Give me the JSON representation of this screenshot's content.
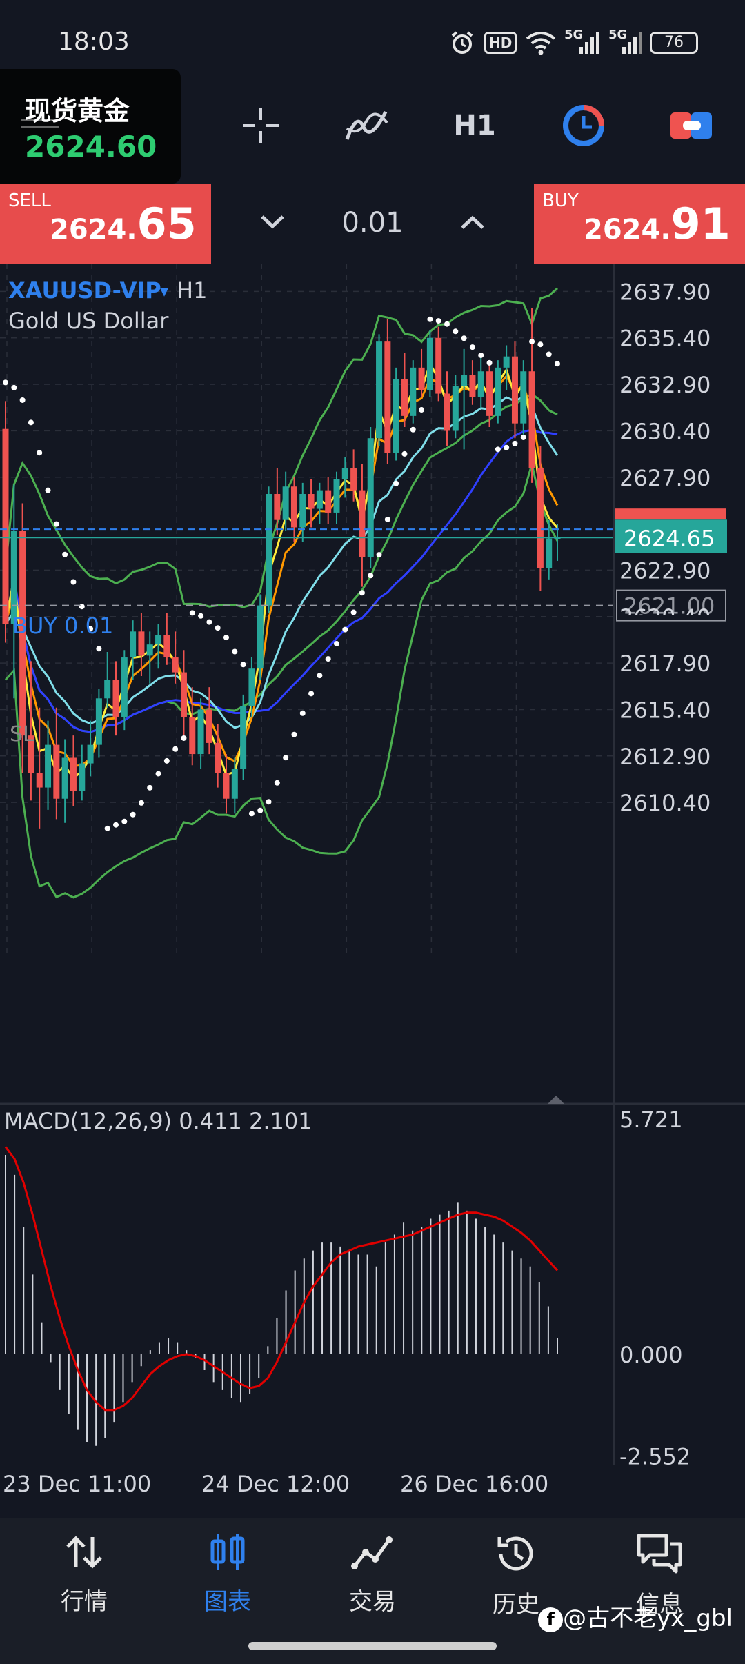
{
  "status_bar": {
    "time": "18:03",
    "icons": [
      "alarm-icon",
      "hd-icon",
      "wifi-icon",
      "signal-5g-icon",
      "signal-5g-icon"
    ],
    "hd_label": "HD",
    "net1": "5G",
    "net2": "5G",
    "battery": "76"
  },
  "symbol_card": {
    "name": "现货黄金",
    "price": "2624.60"
  },
  "toolbar": {
    "crosshair_icon": "crosshair-icon",
    "indicator_icon": "indicator-icon",
    "timeframe": "H1",
    "clock_icon": "chart-clock-icon",
    "toggle_icon": "toggle-icon"
  },
  "trade": {
    "sell_label": "SELL",
    "sell_price_main": "2624.",
    "sell_price_big": "65",
    "lot_minus": "˅",
    "lot": "0.01",
    "lot_plus": "˄",
    "buy_label": "BUY",
    "buy_price_main": "2624.",
    "buy_price_big": "91"
  },
  "chart": {
    "symbol": "XAUUSD-VIP",
    "dropdown_glyph": "▾",
    "timeframe": "H1",
    "description": "Gold US Dollar",
    "position_label": "BUY 0.01",
    "sl_label": "SL",
    "current_price_tag": "2624.65",
    "sl_price_tag": "2621.00",
    "overlap_label": "2620.40",
    "macd_label": "MACD(12,26,9) 0.411 2.101",
    "colors": {
      "bull": "#26a69a",
      "bear": "#ef5350",
      "bb": "#4caf50",
      "ma_fast": "#ffeb3b",
      "ma_mid": "#ff9800",
      "ma_cyan": "#80deea",
      "ma_blue": "#2f3fff",
      "macd_signal": "#e00000"
    }
  },
  "chart_data": [
    {
      "type": "candlestick",
      "title": "XAUUSD-VIP H1",
      "y_ticks": [
        2637.9,
        2635.4,
        2632.9,
        2630.4,
        2627.9,
        2622.9,
        2620.4,
        2617.9,
        2615.4,
        2612.9,
        2610.4
      ],
      "ylim": [
        2608.4,
        2639.4
      ],
      "x_tick_labels": [
        "23 Dec 11:00",
        "24 Dec 12:00",
        "26 Dec 16:00"
      ],
      "x_tick_index": [
        0,
        28,
        56
      ],
      "current_price": 2624.65,
      "stop_loss": 2621.0,
      "position_price": 2625.1,
      "ohlc": [
        [
          2630.5,
          2632.0,
          2619.0,
          2620.0
        ],
        [
          2620.0,
          2627.5,
          2616.0,
          2625.0
        ],
        [
          2625.0,
          2626.5,
          2612.0,
          2614.0
        ],
        [
          2614.0,
          2618.0,
          2610.5,
          2612.0
        ],
        [
          2612.0,
          2615.5,
          2609.0,
          2611.2
        ],
        [
          2611.2,
          2614.8,
          2610.0,
          2613.5
        ],
        [
          2613.5,
          2615.5,
          2609.5,
          2610.6
        ],
        [
          2610.6,
          2613.8,
          2609.3,
          2612.8
        ],
        [
          2612.8,
          2614.0,
          2610.2,
          2611.0
        ],
        [
          2611.0,
          2613.5,
          2610.5,
          2612.5
        ],
        [
          2612.5,
          2614.8,
          2611.8,
          2613.5
        ],
        [
          2613.5,
          2616.5,
          2612.8,
          2616.0
        ],
        [
          2616.0,
          2618.5,
          2615.5,
          2617.0
        ],
        [
          2617.0,
          2618.0,
          2614.0,
          2615.0
        ],
        [
          2615.0,
          2618.6,
          2614.3,
          2618.2
        ],
        [
          2618.2,
          2620.2,
          2617.0,
          2619.6
        ],
        [
          2619.6,
          2620.6,
          2617.2,
          2618.3
        ],
        [
          2618.3,
          2619.6,
          2616.8,
          2618.9
        ],
        [
          2618.9,
          2620.0,
          2617.6,
          2619.4
        ],
        [
          2619.4,
          2620.6,
          2617.8,
          2618.2
        ],
        [
          2618.2,
          2619.6,
          2616.8,
          2617.4
        ],
        [
          2617.4,
          2618.6,
          2614.0,
          2615.0
        ],
        [
          2615.0,
          2616.6,
          2612.4,
          2613.0
        ],
        [
          2613.0,
          2616.0,
          2612.2,
          2615.4
        ],
        [
          2615.4,
          2616.6,
          2613.0,
          2613.6
        ],
        [
          2613.6,
          2614.6,
          2611.2,
          2612.0
        ],
        [
          2612.0,
          2613.0,
          2609.8,
          2610.6
        ],
        [
          2610.6,
          2612.8,
          2609.8,
          2612.2
        ],
        [
          2612.2,
          2616.2,
          2611.6,
          2615.6
        ],
        [
          2615.6,
          2618.2,
          2615.0,
          2617.6
        ],
        [
          2617.6,
          2621.6,
          2617.0,
          2621.0
        ],
        [
          2621.0,
          2627.4,
          2620.6,
          2627.0
        ],
        [
          2627.0,
          2628.4,
          2624.8,
          2625.6
        ],
        [
          2625.6,
          2628.2,
          2625.0,
          2627.4
        ],
        [
          2627.4,
          2627.9,
          2624.4,
          2625.2
        ],
        [
          2625.2,
          2627.6,
          2624.4,
          2627.0
        ],
        [
          2627.0,
          2627.8,
          2625.2,
          2626.2
        ],
        [
          2626.2,
          2627.6,
          2625.4,
          2627.2
        ],
        [
          2627.2,
          2627.9,
          2625.4,
          2626.0
        ],
        [
          2626.0,
          2628.2,
          2625.4,
          2627.8
        ],
        [
          2627.8,
          2629.0,
          2626.8,
          2628.4
        ],
        [
          2628.4,
          2629.4,
          2626.6,
          2627.2
        ],
        [
          2627.2,
          2628.6,
          2622.0,
          2623.6
        ],
        [
          2623.6,
          2630.6,
          2623.0,
          2630.0
        ],
        [
          2630.0,
          2635.6,
          2629.6,
          2635.2
        ],
        [
          2635.2,
          2636.4,
          2628.6,
          2629.2
        ],
        [
          2629.2,
          2633.8,
          2628.8,
          2633.2
        ],
        [
          2633.2,
          2634.6,
          2630.6,
          2631.2
        ],
        [
          2631.2,
          2634.2,
          2630.8,
          2633.8
        ],
        [
          2633.8,
          2634.8,
          2632.2,
          2632.6
        ],
        [
          2632.6,
          2635.8,
          2632.2,
          2635.4
        ],
        [
          2635.4,
          2636.0,
          2632.0,
          2632.4
        ],
        [
          2632.4,
          2633.6,
          2629.6,
          2630.4
        ],
        [
          2630.4,
          2633.4,
          2630.0,
          2632.8
        ],
        [
          2632.8,
          2634.8,
          2629.4,
          2633.4
        ],
        [
          2633.4,
          2634.2,
          2631.8,
          2632.2
        ],
        [
          2632.2,
          2634.4,
          2631.6,
          2633.6
        ],
        [
          2633.6,
          2634.0,
          2630.6,
          2631.2
        ],
        [
          2631.2,
          2634.2,
          2630.8,
          2633.8
        ],
        [
          2633.8,
          2635.0,
          2632.6,
          2634.4
        ],
        [
          2634.4,
          2635.2,
          2630.0,
          2630.8
        ],
        [
          2630.8,
          2634.2,
          2630.2,
          2633.6
        ],
        [
          2633.6,
          2637.0,
          2627.6,
          2628.4
        ],
        [
          2628.4,
          2629.6,
          2621.8,
          2623.0
        ],
        [
          2623.0,
          2625.6,
          2622.4,
          2624.6
        ],
        [
          2624.6,
          2625.4,
          2623.4,
          2624.65
        ]
      ]
    },
    {
      "type": "bar",
      "title": "MACD(12,26,9) 0.411 2.101",
      "y_ticks": [
        5.721,
        0.0,
        -2.552
      ],
      "ylim": [
        -3.1,
        5.9
      ],
      "x_tick_labels": [
        "23 Dec 11:00",
        "24 Dec 12:00",
        "26 Dec 16:00"
      ],
      "histogram": [
        5.0,
        4.5,
        3.2,
        2.0,
        0.8,
        -0.2,
        -0.9,
        -1.5,
        -1.9,
        -2.2,
        -2.3,
        -2.1,
        -1.7,
        -1.2,
        -0.7,
        -0.3,
        0.1,
        0.3,
        0.4,
        0.3,
        0.1,
        -0.1,
        -0.4,
        -0.7,
        -0.9,
        -1.1,
        -1.2,
        -1.0,
        -0.6,
        0.2,
        0.9,
        1.6,
        2.1,
        2.4,
        2.6,
        2.8,
        2.8,
        2.7,
        2.6,
        2.5,
        2.5,
        2.2,
        2.8,
        3.0,
        3.3,
        3.1,
        3.2,
        3.4,
        3.5,
        3.6,
        3.8,
        3.6,
        3.4,
        3.2,
        3.0,
        2.8,
        2.6,
        2.4,
        2.2,
        1.8,
        1.2,
        0.411
      ],
      "signal": [
        5.2,
        4.9,
        4.3,
        3.5,
        2.6,
        1.7,
        0.9,
        0.2,
        -0.4,
        -0.9,
        -1.2,
        -1.4,
        -1.4,
        -1.3,
        -1.1,
        -0.8,
        -0.5,
        -0.3,
        -0.15,
        -0.05,
        0.0,
        -0.05,
        -0.15,
        -0.3,
        -0.45,
        -0.6,
        -0.75,
        -0.85,
        -0.8,
        -0.6,
        -0.2,
        0.3,
        0.8,
        1.3,
        1.7,
        2.0,
        2.3,
        2.5,
        2.6,
        2.7,
        2.75,
        2.8,
        2.85,
        2.9,
        2.95,
        3.0,
        3.1,
        3.2,
        3.3,
        3.4,
        3.5,
        3.55,
        3.55,
        3.5,
        3.45,
        3.35,
        3.2,
        3.05,
        2.85,
        2.6,
        2.35,
        2.101
      ]
    }
  ],
  "nav": [
    {
      "id": "quotes",
      "label": "行情",
      "icon": "up-down-arrows-icon",
      "active": false
    },
    {
      "id": "chart",
      "label": "图表",
      "icon": "candles-icon",
      "active": true
    },
    {
      "id": "trade",
      "label": "交易",
      "icon": "trend-line-icon",
      "active": false
    },
    {
      "id": "history",
      "label": "历史",
      "icon": "history-icon",
      "active": false
    },
    {
      "id": "messages",
      "label": "信息",
      "icon": "chat-icon",
      "active": false
    }
  ],
  "watermark": "@古不老yx_gbl"
}
